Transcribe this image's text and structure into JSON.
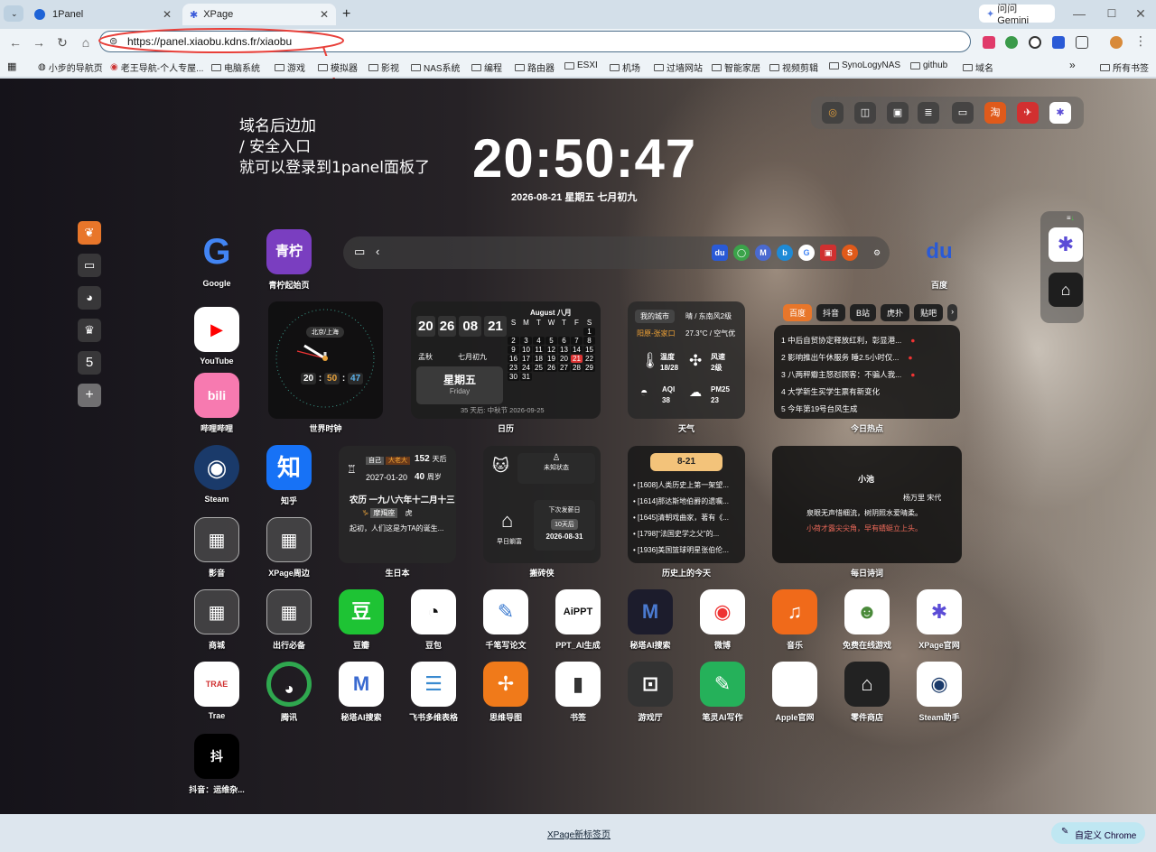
{
  "tabs": [
    {
      "label": "1Panel"
    },
    {
      "label": "XPage"
    }
  ],
  "gemini": "问问 Gemini",
  "url": "https://panel.xiaobu.kdns.fr/xiaobu",
  "bookmarks": [
    "小步的导航页",
    "老王导航-个人专屋...",
    "电脑系统",
    "游戏",
    "模拟器",
    "影视",
    "NAS系统",
    "编程",
    "路由器",
    "ESXI",
    "机场",
    "过墙网站",
    "智能家居",
    "视频剪辑",
    "SynoLogyNAS",
    "github",
    "域名"
  ],
  "bookmarks_all": "所有书签",
  "annotation": [
    "域名后边加",
    "/ 安全入口",
    "就可以登录到1panel面板了"
  ],
  "clock": {
    "time": "20:50:47",
    "date": "2026-08-21 星期五 七月初九"
  },
  "sidebar_number": "5",
  "apps_row1": [
    {
      "label": "Google",
      "text": "G"
    },
    {
      "label": "青柠起始页",
      "text": "青柠"
    }
  ],
  "baidu": {
    "label": "百度",
    "text": "du"
  },
  "apps_col": [
    {
      "label": "YouTube",
      "text": "▶"
    },
    {
      "label": "哔哩哔哩",
      "text": "bili"
    },
    {
      "label": "Steam",
      "text": "◉"
    },
    {
      "label": "知乎",
      "text": "知"
    },
    {
      "label": "影音",
      "text": "▦"
    },
    {
      "label": "XPage周边",
      "text": "▦"
    },
    {
      "label": "商城",
      "text": "▦"
    },
    {
      "label": "出行必备",
      "text": "▦"
    },
    {
      "label": "Trae",
      "text": "TRAE"
    },
    {
      "label": "腾讯",
      "text": "◕"
    },
    {
      "label": "抖音：运维杂...",
      "text": "抖"
    }
  ],
  "world_clock": {
    "label": "世界时钟",
    "city": "北京/上海",
    "h": "20",
    "m": "50",
    "s": "47"
  },
  "calendar": {
    "label": "日历",
    "digits": [
      "20",
      "26",
      "08",
      "21"
    ],
    "month": "August 八月",
    "weekday": "星期五",
    "weekday_en": "Friday",
    "lunar": "七月初九",
    "tag": "孟秋",
    "weekhead": [
      "S",
      "M",
      "T",
      "W",
      "T",
      "F",
      "S"
    ],
    "days": [
      "",
      "",
      "",
      "",
      "",
      "",
      "1",
      "2",
      "3",
      "4",
      "5",
      "6",
      "7",
      "8",
      "9",
      "10",
      "11",
      "12",
      "13",
      "14",
      "15",
      "16",
      "17",
      "18",
      "19",
      "20",
      "21",
      "22",
      "23",
      "24",
      "25",
      "26",
      "27",
      "28",
      "29",
      "30",
      "31",
      "",
      "",
      "",
      "",
      ""
    ],
    "footer": "35 天后: 中秋节 2026-09-25"
  },
  "weather": {
    "label": "天气",
    "city": "我的城市",
    "cond": "晴 / 东南风2级",
    "loc": "阳原-张家口",
    "temp_line": "27.3°C / 空气优",
    "items": [
      {
        "k": "温度",
        "v": "18/28"
      },
      {
        "k": "风速",
        "v": "2级"
      },
      {
        "k": "AQI",
        "v": "38"
      },
      {
        "k": "PM25",
        "v": "23"
      }
    ]
  },
  "hot": {
    "label": "今日热点",
    "tabs": [
      "百度",
      "抖音",
      "B站",
      "虎扑",
      "贴吧"
    ],
    "items": [
      "中后自贸协定释放红利，彰显港...",
      "影响推出午休服务 睡2.5小时仅...",
      "八两秤瓣主怒怼顾客：不骗人我...",
      "大学新生买学生票有新变化",
      "今年第19号台风生成"
    ]
  },
  "birthday": {
    "label": "生日本",
    "tag1": "自己",
    "tag2": "大老大",
    "days_after": "152",
    "unit1": "天后",
    "date": "2027-01-20",
    "age": "40",
    "unit2": "周岁",
    "lunar": "农历 一九八六年十二月十三",
    "zodiac": "摩羯座",
    "animal": "虎",
    "note": "起初，人们这是为TA的诞生..."
  },
  "salary": {
    "label": "搬砖侠",
    "status": "未知状态",
    "next": "下次发薪日",
    "days": "10天后",
    "date": "2026-08-31",
    "left": "早日躺富"
  },
  "history": {
    "label": "历史上的今天",
    "date": "8-21",
    "items": [
      "[1608]人类历史上第一架望...",
      "[1614]那达斯地伯爵的遗嘱...",
      "[1645]清朝戏曲家，著有《...",
      "[1798]“法国史学之父”的...",
      "[1936]美国篮球明星张伯伦..."
    ]
  },
  "poem": {
    "label": "每日诗词",
    "title": "小池",
    "author": "杨万里 宋代",
    "line1": "泉眼无声惜细流，树阴照水爱晴柔。",
    "line2": "小荷才露尖尖角，早有蜻蜓立上头。"
  },
  "apps_row4": [
    {
      "label": "豆瓣",
      "text": "豆"
    },
    {
      "label": "豆包",
      "text": "◔"
    },
    {
      "label": "千笔写论文",
      "text": "✎"
    },
    {
      "label": "PPT_AI生成",
      "text": "AiPPT"
    },
    {
      "label": "秘塔AI搜索",
      "text": "M"
    },
    {
      "label": "微博",
      "text": "◉"
    },
    {
      "label": "音乐",
      "text": "♫"
    },
    {
      "label": "免费在线游戏",
      "text": "☻"
    },
    {
      "label": "XPage官网",
      "text": "✱"
    }
  ],
  "apps_row5": [
    {
      "label": "秘塔AI搜索",
      "text": "M"
    },
    {
      "label": "飞书多维表格",
      "text": "☰"
    },
    {
      "label": "思维导图",
      "text": "✢"
    },
    {
      "label": "书签",
      "text": "▮"
    },
    {
      "label": "游戏厅",
      "text": "⊡"
    },
    {
      "label": "笔灵AI写作",
      "text": "✎"
    },
    {
      "label": "Apple官网",
      "text": ""
    },
    {
      "label": "零件商店",
      "text": "⌂"
    },
    {
      "label": "Steam助手",
      "text": "◉"
    }
  ],
  "footer": {
    "link": "XPage新标签页",
    "customize": "自定义 Chrome"
  }
}
